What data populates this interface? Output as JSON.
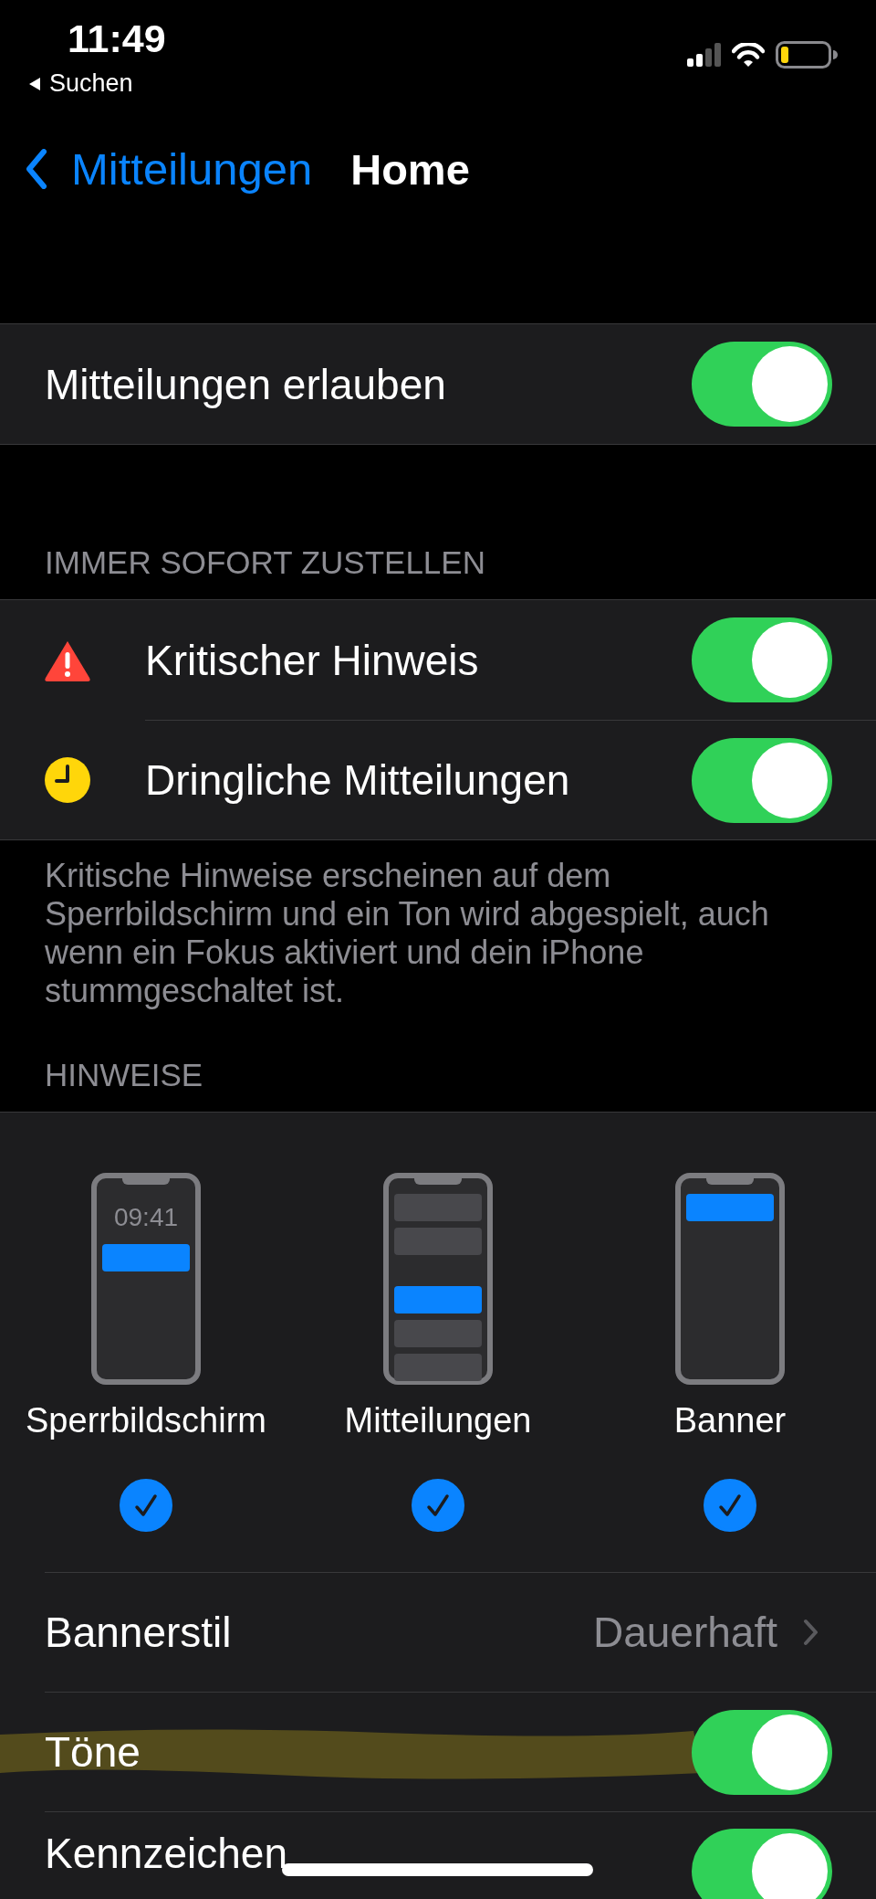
{
  "status_bar": {
    "time": "11:49",
    "back_app": "Suchen"
  },
  "nav": {
    "back_label": "Mitteilungen",
    "title": "Home"
  },
  "allow": {
    "label": "Mitteilungen erlauben",
    "on": true
  },
  "immediate": {
    "header": "IMMER SOFORT ZUSTELLEN",
    "rows": [
      {
        "kind": "warning",
        "label": "Kritischer Hinweis",
        "on": true
      },
      {
        "kind": "clock",
        "label": "Dringliche Mitteilungen",
        "on": true
      }
    ],
    "footer": "Kritische Hinweise erscheinen auf dem Sperrbildschirm und ein Ton wird abgespielt, auch wenn ein Fokus aktiviert und dein iPhone stummgeschaltet ist."
  },
  "alerts": {
    "header": "HINWEISE",
    "styles": [
      {
        "kind": "lock_screen",
        "label": "Sperrbildschirm",
        "preview_time": "09:41",
        "selected": true
      },
      {
        "kind": "center",
        "label": "Mitteilungen",
        "selected": true
      },
      {
        "kind": "banner",
        "label": "Banner",
        "selected": true
      }
    ],
    "rows": [
      {
        "kind": "link",
        "label": "Bannerstil",
        "value": "Dauerhaft"
      },
      {
        "kind": "toggle",
        "label": "Töne",
        "on": true,
        "highlighted": true
      },
      {
        "kind": "toggle",
        "label": "Kennzeichen",
        "on": true
      }
    ]
  }
}
